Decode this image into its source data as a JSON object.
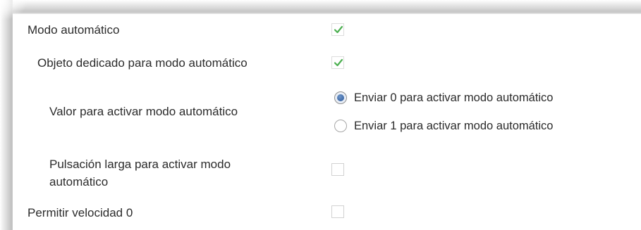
{
  "settings": {
    "modo_automatico": {
      "label": "Modo automático",
      "checked": true
    },
    "objeto_dedicado": {
      "label": "Objeto dedicado para modo automático",
      "checked": true
    },
    "valor_activar": {
      "label": "Valor para activar modo automático",
      "options": [
        {
          "label": "Enviar 0 para activar modo automático",
          "selected": true
        },
        {
          "label": "Enviar 1 para activar modo automático",
          "selected": false
        }
      ]
    },
    "pulsacion_larga": {
      "label": "Pulsación larga para activar modo automático",
      "checked": false
    },
    "permitir_velocidad": {
      "label": "Permitir velocidad 0",
      "checked": false
    }
  },
  "colors": {
    "check_green": "#4caf50",
    "radio_blue": "#3e6aa8",
    "text": "#2b2b2b"
  },
  "icons": {
    "check": "check-icon",
    "radio_dot": "radio-dot-icon"
  }
}
